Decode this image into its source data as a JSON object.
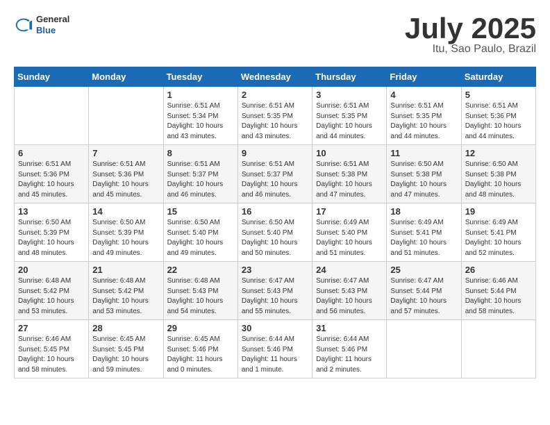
{
  "header": {
    "logo": {
      "general": "General",
      "blue": "Blue"
    },
    "title": "July 2025",
    "location": "Itu, Sao Paulo, Brazil"
  },
  "days_of_week": [
    "Sunday",
    "Monday",
    "Tuesday",
    "Wednesday",
    "Thursday",
    "Friday",
    "Saturday"
  ],
  "weeks": [
    [
      {
        "day": "",
        "info": ""
      },
      {
        "day": "",
        "info": ""
      },
      {
        "day": "1",
        "info": "Sunrise: 6:51 AM\nSunset: 5:34 PM\nDaylight: 10 hours\nand 43 minutes."
      },
      {
        "day": "2",
        "info": "Sunrise: 6:51 AM\nSunset: 5:35 PM\nDaylight: 10 hours\nand 43 minutes."
      },
      {
        "day": "3",
        "info": "Sunrise: 6:51 AM\nSunset: 5:35 PM\nDaylight: 10 hours\nand 44 minutes."
      },
      {
        "day": "4",
        "info": "Sunrise: 6:51 AM\nSunset: 5:35 PM\nDaylight: 10 hours\nand 44 minutes."
      },
      {
        "day": "5",
        "info": "Sunrise: 6:51 AM\nSunset: 5:36 PM\nDaylight: 10 hours\nand 44 minutes."
      }
    ],
    [
      {
        "day": "6",
        "info": "Sunrise: 6:51 AM\nSunset: 5:36 PM\nDaylight: 10 hours\nand 45 minutes."
      },
      {
        "day": "7",
        "info": "Sunrise: 6:51 AM\nSunset: 5:36 PM\nDaylight: 10 hours\nand 45 minutes."
      },
      {
        "day": "8",
        "info": "Sunrise: 6:51 AM\nSunset: 5:37 PM\nDaylight: 10 hours\nand 46 minutes."
      },
      {
        "day": "9",
        "info": "Sunrise: 6:51 AM\nSunset: 5:37 PM\nDaylight: 10 hours\nand 46 minutes."
      },
      {
        "day": "10",
        "info": "Sunrise: 6:51 AM\nSunset: 5:38 PM\nDaylight: 10 hours\nand 47 minutes."
      },
      {
        "day": "11",
        "info": "Sunrise: 6:50 AM\nSunset: 5:38 PM\nDaylight: 10 hours\nand 47 minutes."
      },
      {
        "day": "12",
        "info": "Sunrise: 6:50 AM\nSunset: 5:38 PM\nDaylight: 10 hours\nand 48 minutes."
      }
    ],
    [
      {
        "day": "13",
        "info": "Sunrise: 6:50 AM\nSunset: 5:39 PM\nDaylight: 10 hours\nand 48 minutes."
      },
      {
        "day": "14",
        "info": "Sunrise: 6:50 AM\nSunset: 5:39 PM\nDaylight: 10 hours\nand 49 minutes."
      },
      {
        "day": "15",
        "info": "Sunrise: 6:50 AM\nSunset: 5:40 PM\nDaylight: 10 hours\nand 49 minutes."
      },
      {
        "day": "16",
        "info": "Sunrise: 6:50 AM\nSunset: 5:40 PM\nDaylight: 10 hours\nand 50 minutes."
      },
      {
        "day": "17",
        "info": "Sunrise: 6:49 AM\nSunset: 5:40 PM\nDaylight: 10 hours\nand 51 minutes."
      },
      {
        "day": "18",
        "info": "Sunrise: 6:49 AM\nSunset: 5:41 PM\nDaylight: 10 hours\nand 51 minutes."
      },
      {
        "day": "19",
        "info": "Sunrise: 6:49 AM\nSunset: 5:41 PM\nDaylight: 10 hours\nand 52 minutes."
      }
    ],
    [
      {
        "day": "20",
        "info": "Sunrise: 6:48 AM\nSunset: 5:42 PM\nDaylight: 10 hours\nand 53 minutes."
      },
      {
        "day": "21",
        "info": "Sunrise: 6:48 AM\nSunset: 5:42 PM\nDaylight: 10 hours\nand 53 minutes."
      },
      {
        "day": "22",
        "info": "Sunrise: 6:48 AM\nSunset: 5:43 PM\nDaylight: 10 hours\nand 54 minutes."
      },
      {
        "day": "23",
        "info": "Sunrise: 6:47 AM\nSunset: 5:43 PM\nDaylight: 10 hours\nand 55 minutes."
      },
      {
        "day": "24",
        "info": "Sunrise: 6:47 AM\nSunset: 5:43 PM\nDaylight: 10 hours\nand 56 minutes."
      },
      {
        "day": "25",
        "info": "Sunrise: 6:47 AM\nSunset: 5:44 PM\nDaylight: 10 hours\nand 57 minutes."
      },
      {
        "day": "26",
        "info": "Sunrise: 6:46 AM\nSunset: 5:44 PM\nDaylight: 10 hours\nand 58 minutes."
      }
    ],
    [
      {
        "day": "27",
        "info": "Sunrise: 6:46 AM\nSunset: 5:45 PM\nDaylight: 10 hours\nand 58 minutes."
      },
      {
        "day": "28",
        "info": "Sunrise: 6:45 AM\nSunset: 5:45 PM\nDaylight: 10 hours\nand 59 minutes."
      },
      {
        "day": "29",
        "info": "Sunrise: 6:45 AM\nSunset: 5:46 PM\nDaylight: 11 hours\nand 0 minutes."
      },
      {
        "day": "30",
        "info": "Sunrise: 6:44 AM\nSunset: 5:46 PM\nDaylight: 11 hours\nand 1 minute."
      },
      {
        "day": "31",
        "info": "Sunrise: 6:44 AM\nSunset: 5:46 PM\nDaylight: 11 hours\nand 2 minutes."
      },
      {
        "day": "",
        "info": ""
      },
      {
        "day": "",
        "info": ""
      }
    ]
  ]
}
